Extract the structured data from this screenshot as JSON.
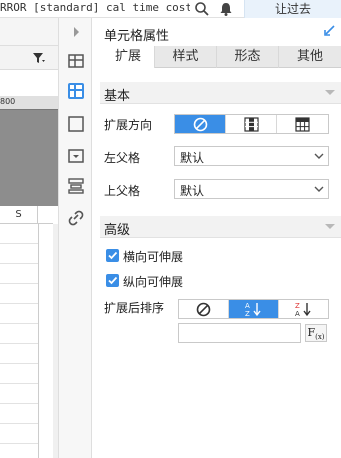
{
  "topbar": {
    "error_text": "RROR [standard] cal time cost...",
    "icons": [
      "search-icon",
      "bell-icon"
    ],
    "signin_label": "让过去"
  },
  "left_sheet": {
    "ruler_label": "800",
    "column_header": "S"
  },
  "panel": {
    "title": "单元格属性",
    "tabs": [
      "扩展",
      "样式",
      "形态",
      "其他"
    ],
    "active_tab": 0,
    "basic_section": "基本",
    "expand_direction_label": "扩展方向",
    "expand_direction_options": [
      "no-expand-icon",
      "vertical-expand-icon",
      "horizontal-expand-icon"
    ],
    "expand_direction_selected": 0,
    "left_parent_label": "左父格",
    "left_parent_value": "默认",
    "top_parent_label": "上父格",
    "top_parent_value": "默认",
    "advanced_section": "高级",
    "h_extend_label": "横向可伸展",
    "h_extend_checked": true,
    "v_extend_label": "纵向可伸展",
    "v_extend_checked": true,
    "sort_label": "扩展后排序",
    "sort_options": [
      "no-sort-icon",
      "sort-ascending-icon",
      "sort-descending-icon"
    ],
    "sort_selected": 1,
    "formula_value": "",
    "fx_label": "F",
    "fx_sub": "(x)"
  },
  "colors": {
    "accent": "#3a8ee6",
    "section_bg": "#f2f2f2",
    "tab_bg": "#e8e8e8",
    "signin_bg": "#e9f2fb"
  }
}
